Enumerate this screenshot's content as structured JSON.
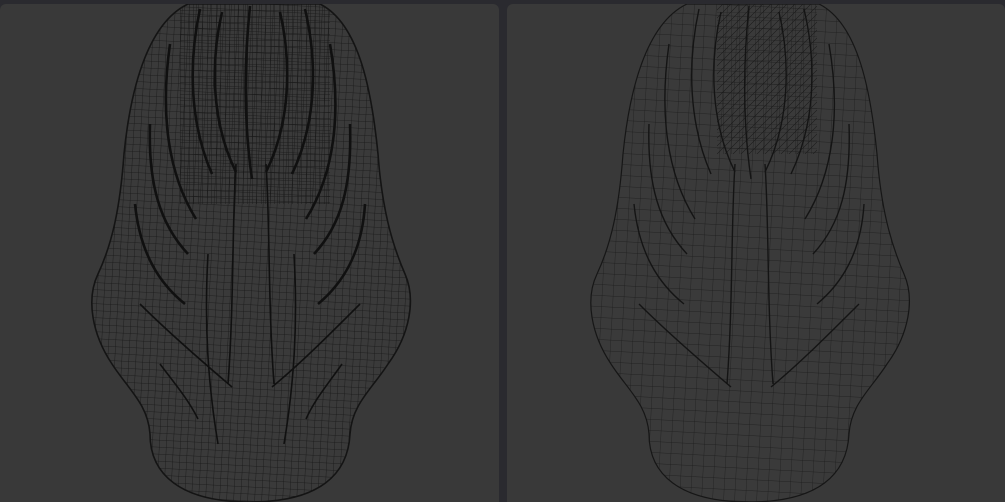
{
  "viewports": [
    {
      "mesh": "hair-mesh-dense-wireframe",
      "colors": {
        "background": "#393939",
        "wire": "#161616"
      }
    },
    {
      "mesh": "hair-mesh-light-wireframe",
      "colors": {
        "background": "#393939",
        "wire": "#1a1a1a"
      }
    }
  ]
}
